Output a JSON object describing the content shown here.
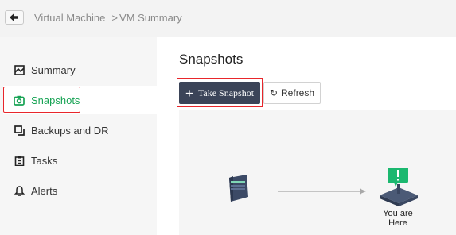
{
  "breadcrumb": {
    "root": "Virtual Machine",
    "separator": ">",
    "current": "VM Summary"
  },
  "sidebar": {
    "items": [
      {
        "label": "Summary",
        "icon": "summary-icon",
        "active": false
      },
      {
        "label": "Snapshots",
        "icon": "camera-icon",
        "active": true
      },
      {
        "label": "Backups and DR",
        "icon": "backup-icon",
        "active": false
      },
      {
        "label": "Tasks",
        "icon": "tasks-icon",
        "active": false
      },
      {
        "label": "Alerts",
        "icon": "bell-icon",
        "active": false
      }
    ]
  },
  "main": {
    "title": "Snapshots",
    "take_snapshot_label": "Take Snapshot",
    "refresh_label": "Refresh",
    "diagram": {
      "current_label": "You are Here"
    }
  },
  "colors": {
    "accent_green": "#17a354",
    "primary_button": "#3b4458",
    "highlight_red": "#e8262b"
  }
}
